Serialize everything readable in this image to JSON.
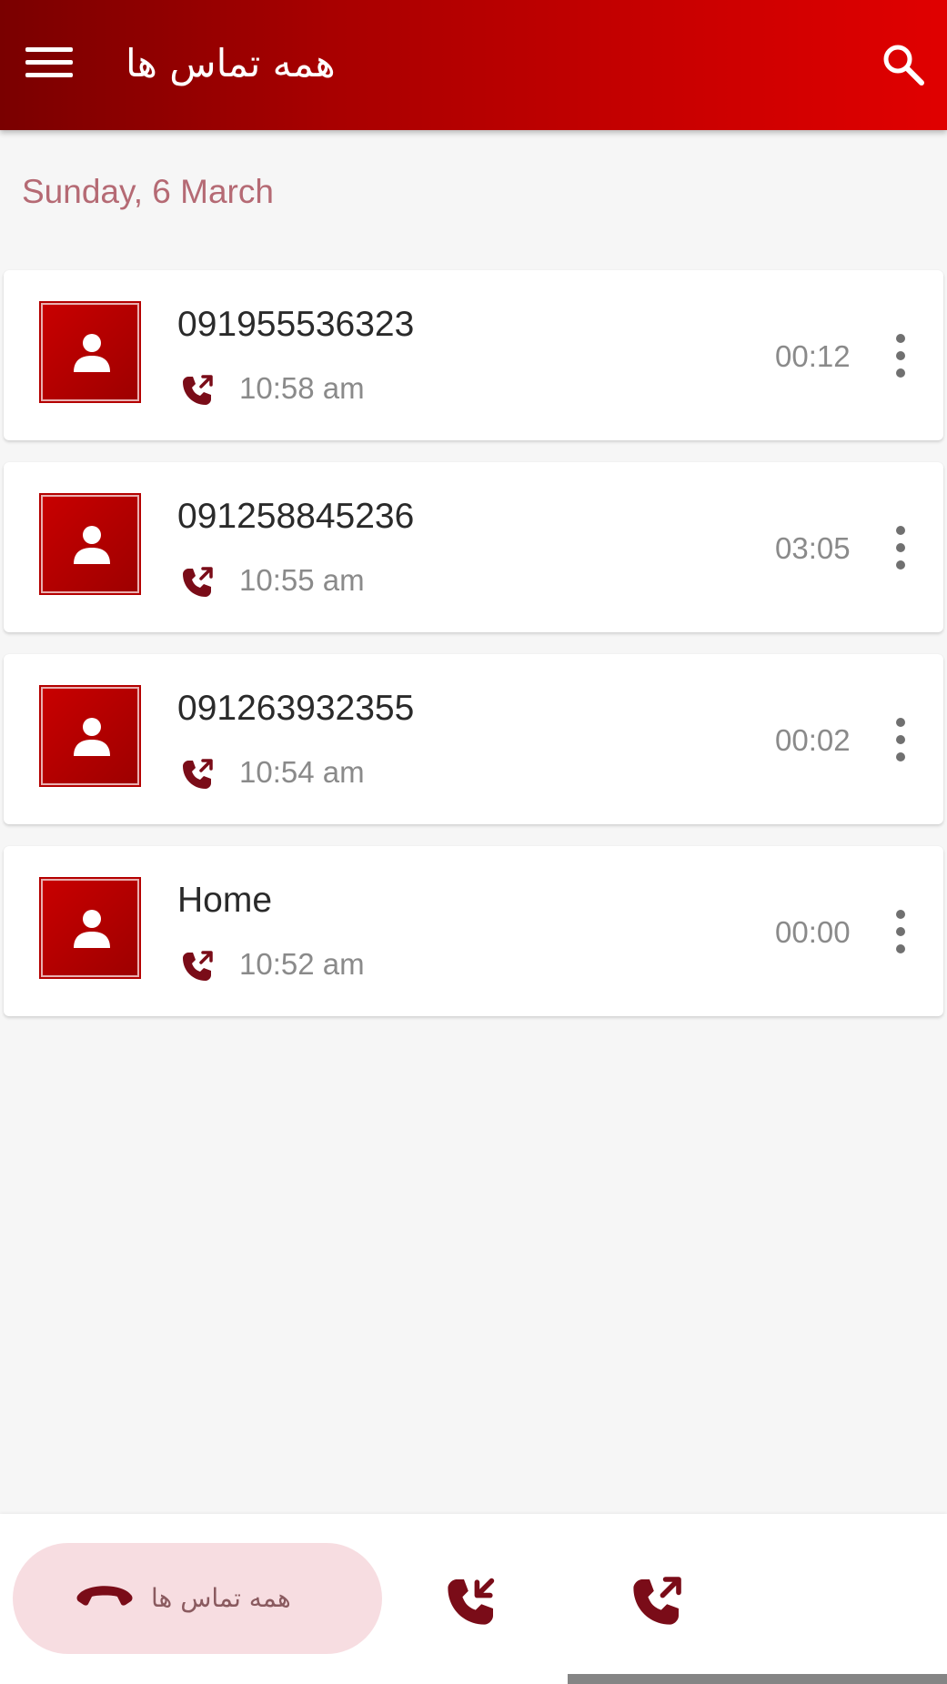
{
  "app_bar": {
    "title": "همه تماس ها",
    "menu_icon": "hamburger-menu-icon",
    "search_icon": "search-icon",
    "background_colors": [
      "#7a0000",
      "#e00000"
    ]
  },
  "date_header": "Sunday, 6 March",
  "calls": [
    {
      "name": "091955536323",
      "time": "10:58 am",
      "duration": "00:12",
      "type": "outgoing"
    },
    {
      "name": "091258845236",
      "time": "10:55 am",
      "duration": "03:05",
      "type": "outgoing"
    },
    {
      "name": "091263932355",
      "time": "10:54 am",
      "duration": "00:02",
      "type": "outgoing"
    },
    {
      "name": "Home",
      "time": "10:52 am",
      "duration": "00:00",
      "type": "outgoing"
    }
  ],
  "bottom_nav": {
    "all_calls_label": "همه تماس ها",
    "all_calls_icon": "hangup-phone-icon",
    "incoming_icon": "incoming-call-icon",
    "outgoing_icon": "outgoing-call-icon",
    "active_tab": "all_calls",
    "active_color": "#f7dde1"
  },
  "colors": {
    "accent": "#b00000",
    "icon": "#7a0c18",
    "date_text": "#b56a74",
    "secondary_text": "#8a8a8a"
  }
}
